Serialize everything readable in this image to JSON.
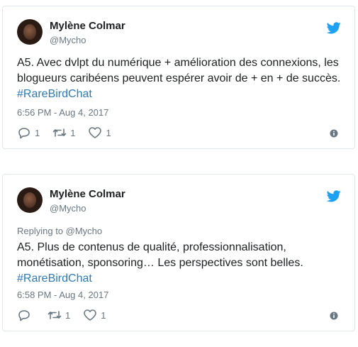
{
  "tweets": [
    {
      "author_name": "Mylène Colmar",
      "author_handle": "@Mycho",
      "replying_to": "",
      "text": "A5. Avec dvlpt du numérique + amélioration des connexions, les blogueurs caribéens peuvent espérer avoir de + en + de succès.",
      "hashtag": "#RareBirdChat",
      "timestamp": "6:56 PM - Aug 4, 2017",
      "reply_count": "1",
      "retweet_count": "1",
      "like_count": "1"
    },
    {
      "author_name": "Mylène Colmar",
      "author_handle": "@Mycho",
      "replying_to": "Replying to @Mycho",
      "text": "A5. Plus de contenus de qualité, professionnalisation, monétisation, sponsoring… Les perspectives sont belles.",
      "hashtag": "#RareBirdChat",
      "timestamp": "6:58 PM - Aug 4, 2017",
      "reply_count": "",
      "retweet_count": "1",
      "like_count": "1"
    }
  ],
  "icons": {
    "brand": "twitter-bird-icon",
    "reply": "reply-icon",
    "retweet": "retweet-icon",
    "like": "heart-icon",
    "info": "info-icon"
  },
  "colors": {
    "brand_blue": "#1da1f2",
    "link_blue": "#2b7bb9",
    "muted": "#697882",
    "border": "#e1e8ed"
  }
}
